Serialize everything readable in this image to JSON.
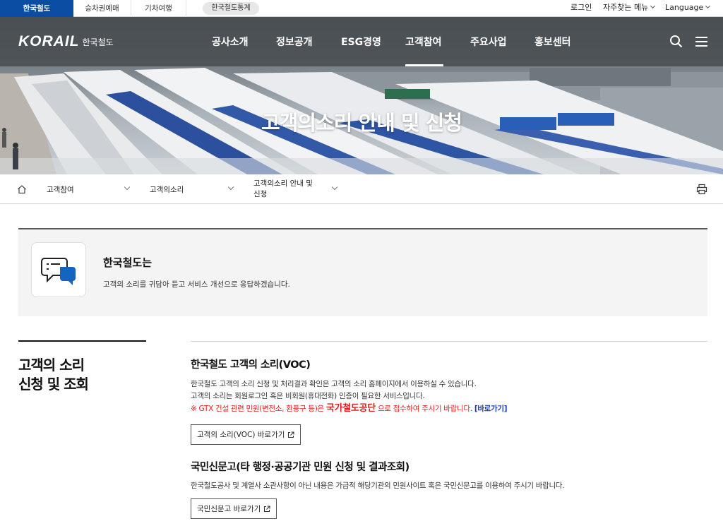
{
  "util_bar": {
    "tabs": [
      {
        "label": "한국철도",
        "active": true
      },
      {
        "label": "승차권예매",
        "active": false
      },
      {
        "label": "기차여행",
        "active": false
      }
    ],
    "pill": "한국철도통계",
    "login": "로그인",
    "faq_menu": "자주찾는 메뉴",
    "language": "Language"
  },
  "header": {
    "logo_word": "KORAIL",
    "logo_sub": "한국철도",
    "nav": [
      "공사소개",
      "정보공개",
      "ESG경영",
      "고객참여",
      "주요사업",
      "홍보센터"
    ],
    "active_nav": "고객참여",
    "icons": [
      "search-icon",
      "menu-icon"
    ]
  },
  "hero": {
    "title": "고객의소리 안내 및 신청"
  },
  "breadcrumb": {
    "items": [
      "고객참여",
      "고객의소리",
      "고객의소리 안내 및 신청"
    ]
  },
  "intro": {
    "title": "한국철도는",
    "desc": "고객의 소리를 귀담아 듣고 서비스 개선으로 응답하겠습니다."
  },
  "side": {
    "title_line1": "고객의 소리",
    "title_line2": "신청 및 조회"
  },
  "voc": {
    "title": "한국철도 고객의 소리(VOC)",
    "line1": "한국철도 고객의 소리 신청 및 처리결과 확인은 고객의 소리 홈페이지에서 이용하실 수 있습니다.",
    "line2": "고객의 소리는 회원로그인 혹은 비회원(휴대전화) 인증이 필요한 서비스입니다.",
    "notice_pre": "※ GTX 건설 관련 민원(변전소, 환풍구 등)은",
    "notice_strong": "국가철도공단",
    "notice_post": "으로 접수하여 주시기 바랍니다.",
    "notice_link": "[바로가기]",
    "button": "고객의 소리(VOC) 바로가기"
  },
  "epeople": {
    "title": "국민신문고(타 행정·공공기관 민원 신청 및 결과조회)",
    "line1": "한국철도공사 및 계열사 소관사항이 아닌 내용은 가급적 해당기관의 민원사이트 혹은 국민신문고를 이용하여 주시기 바랍니다.",
    "button": "국민신문고 바로가기"
  },
  "colors": {
    "brand_blue": "#0a4da3",
    "notice_red": "#e0201e",
    "link_blue": "#1a3fb0"
  }
}
